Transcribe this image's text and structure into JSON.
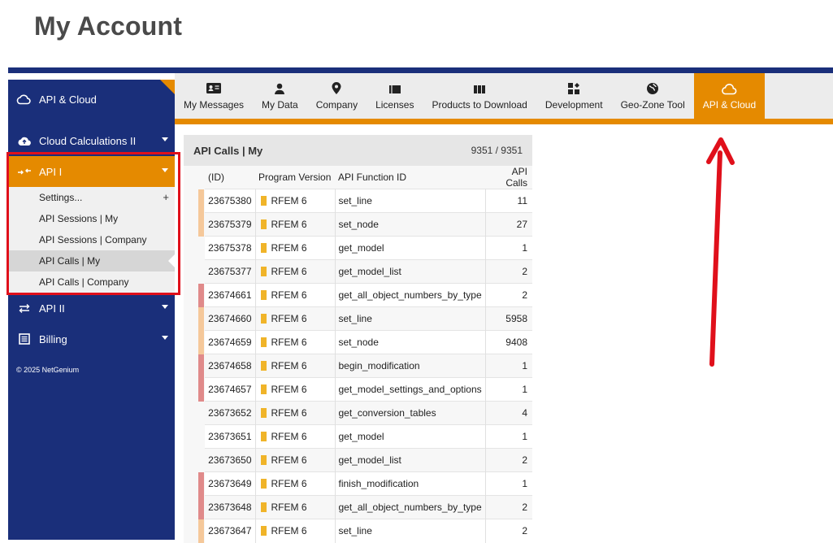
{
  "page_title": "My Account",
  "sidebar": {
    "header_label": "API & Cloud",
    "items": [
      {
        "label": "Cloud Calculations II",
        "icon": "cloud-upload-icon"
      },
      {
        "label": "API I",
        "icon": "api-arrows-in-icon"
      },
      {
        "label": "API II",
        "icon": "api-arrows-swap-icon"
      },
      {
        "label": "Billing",
        "icon": "billing-icon"
      }
    ],
    "api1_submenu": [
      {
        "label": "Settings...",
        "plus": "+"
      },
      {
        "label": "API Sessions | My"
      },
      {
        "label": "API Sessions | Company"
      },
      {
        "label": "API Calls | My"
      },
      {
        "label": "API Calls | Company"
      }
    ],
    "copyright": "© 2025 NetGenium"
  },
  "tabs": [
    {
      "label": "My Messages",
      "icon": "messages-icon"
    },
    {
      "label": "My Data",
      "icon": "user-icon"
    },
    {
      "label": "Company",
      "icon": "location-pin-icon"
    },
    {
      "label": "Licenses",
      "icon": "licenses-icon"
    },
    {
      "label": "Products to Download",
      "icon": "download-products-icon"
    },
    {
      "label": "Development",
      "icon": "development-icon"
    },
    {
      "label": "Geo-Zone Tool",
      "icon": "globe-icon"
    },
    {
      "label": "API & Cloud",
      "icon": "cloud-icon"
    }
  ],
  "panel": {
    "title": "API Calls | My",
    "count": "9351 / 9351",
    "columns": [
      "(ID)",
      "Program Version",
      "API Function ID",
      "API Calls"
    ],
    "rows": [
      {
        "id": "23675380",
        "version": "RFEM 6",
        "fn": "set_line",
        "calls": "11",
        "mark": "#f5c89a"
      },
      {
        "id": "23675379",
        "version": "RFEM 6",
        "fn": "set_node",
        "calls": "27",
        "mark": "#f5c89a"
      },
      {
        "id": "23675378",
        "version": "RFEM 6",
        "fn": "get_model",
        "calls": "1",
        "mark": ""
      },
      {
        "id": "23675377",
        "version": "RFEM 6",
        "fn": "get_model_list",
        "calls": "2",
        "mark": ""
      },
      {
        "id": "23674661",
        "version": "RFEM 6",
        "fn": "get_all_object_numbers_by_type",
        "calls": "2",
        "mark": "#e08a8a"
      },
      {
        "id": "23674660",
        "version": "RFEM 6",
        "fn": "set_line",
        "calls": "5958",
        "mark": "#f5c89a"
      },
      {
        "id": "23674659",
        "version": "RFEM 6",
        "fn": "set_node",
        "calls": "9408",
        "mark": "#f5c89a"
      },
      {
        "id": "23674658",
        "version": "RFEM 6",
        "fn": "begin_modification",
        "calls": "1",
        "mark": "#e08a8a"
      },
      {
        "id": "23674657",
        "version": "RFEM 6",
        "fn": "get_model_settings_and_options",
        "calls": "1",
        "mark": "#e08a8a"
      },
      {
        "id": "23673652",
        "version": "RFEM 6",
        "fn": "get_conversion_tables",
        "calls": "4",
        "mark": ""
      },
      {
        "id": "23673651",
        "version": "RFEM 6",
        "fn": "get_model",
        "calls": "1",
        "mark": ""
      },
      {
        "id": "23673650",
        "version": "RFEM 6",
        "fn": "get_model_list",
        "calls": "2",
        "mark": ""
      },
      {
        "id": "23673649",
        "version": "RFEM 6",
        "fn": "finish_modification",
        "calls": "1",
        "mark": "#e08a8a"
      },
      {
        "id": "23673648",
        "version": "RFEM 6",
        "fn": "get_all_object_numbers_by_type",
        "calls": "2",
        "mark": "#e08a8a"
      },
      {
        "id": "23673647",
        "version": "RFEM 6",
        "fn": "set_line",
        "calls": "2",
        "mark": "#f5c89a"
      }
    ]
  },
  "colors": {
    "navy": "#1a2f7a",
    "orange": "#e58a00",
    "highlight_red": "#e0101b"
  }
}
